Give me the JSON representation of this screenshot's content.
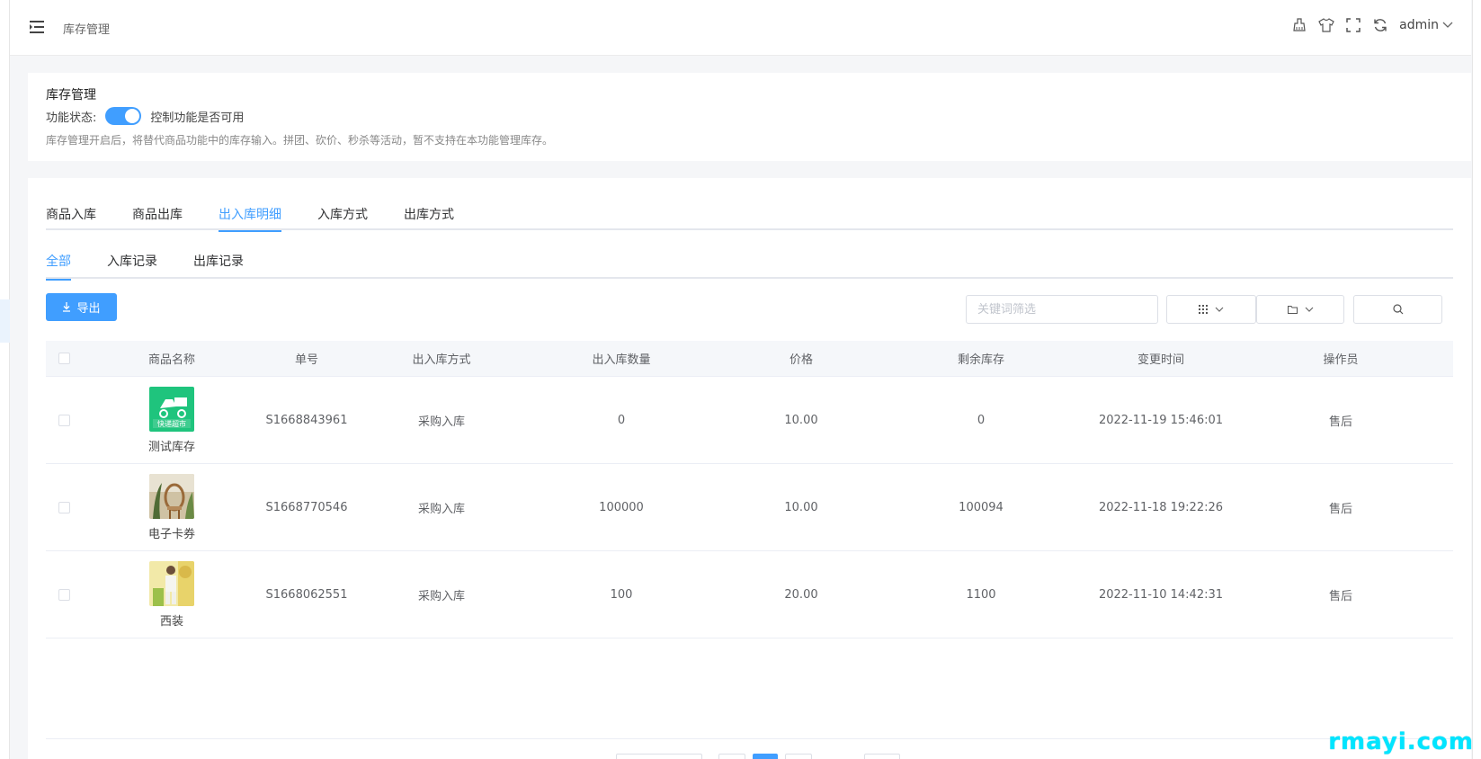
{
  "header": {
    "breadcrumb": "库存管理",
    "user": "admin"
  },
  "settings": {
    "title": "库存管理",
    "status_label": "功能状态:",
    "status_enabled": true,
    "status_hint": "控制功能是否可用",
    "description": "库存管理开启后，将替代商品功能中的库存输入。拼团、砍价、秒杀等活动，暂不支持在本功能管理库存。"
  },
  "tabs": [
    "商品入库",
    "商品出库",
    "出入库明细",
    "入库方式",
    "出库方式"
  ],
  "active_tab": "出入库明细",
  "subtabs": [
    "全部",
    "入库记录",
    "出库记录"
  ],
  "active_subtab": "全部",
  "toolbar": {
    "export_label": "导出",
    "search_placeholder": "关键词筛选"
  },
  "table": {
    "columns": [
      "商品名称",
      "单号",
      "出入库方式",
      "出入库数量",
      "价格",
      "剩余库存",
      "变更时间",
      "操作员"
    ],
    "rows": [
      {
        "name": "测试库存",
        "order_no": "S1668843961",
        "method": "采购入库",
        "qty": "0",
        "price": "10.00",
        "stock": "0",
        "time": "2022-11-19 15:46:01",
        "operator": "售后",
        "thumb_text": "快递超市"
      },
      {
        "name": "电子卡券",
        "order_no": "S1668770546",
        "method": "采购入库",
        "qty": "100000",
        "price": "10.00",
        "stock": "100094",
        "time": "2022-11-18 19:22:26",
        "operator": "售后",
        "thumb_text": ""
      },
      {
        "name": "西装",
        "order_no": "S1668062551",
        "method": "采购入库",
        "qty": "100",
        "price": "20.00",
        "stock": "1100",
        "time": "2022-11-10 14:42:31",
        "operator": "售后",
        "thumb_text": ""
      }
    ]
  },
  "watermark": "rmayi.com",
  "colors": {
    "primary": "#409eff",
    "watermark": "#00e5ff"
  }
}
